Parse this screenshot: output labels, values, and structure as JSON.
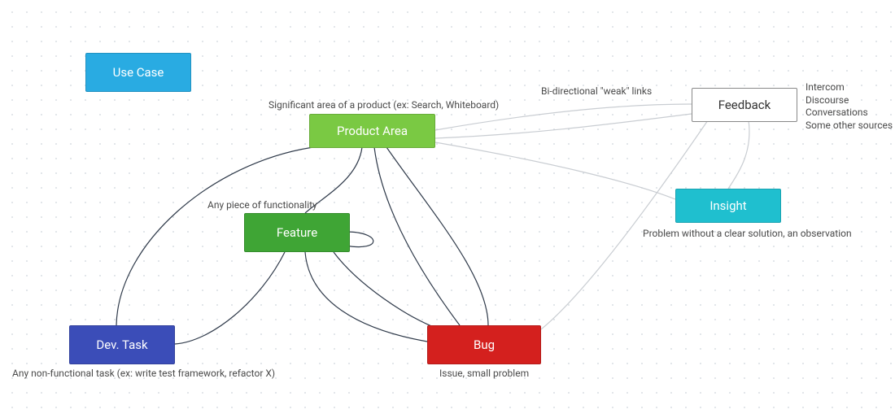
{
  "nodes": {
    "use_case": {
      "label": "Use Case",
      "color": "#29ABE2"
    },
    "product_area": {
      "label": "Product Area",
      "color": "#7AC943"
    },
    "feature": {
      "label": "Feature",
      "color": "#3FA535"
    },
    "dev_task": {
      "label": "Dev. Task",
      "color": "#3B4DB8"
    },
    "bug": {
      "label": "Bug",
      "color": "#D4201E"
    },
    "feedback": {
      "label": "Feedback",
      "color": "#FFFFFF",
      "text": "#333333",
      "border": "#888888"
    },
    "insight": {
      "label": "Insight",
      "color": "#1FBFCF"
    }
  },
  "annotations": {
    "product_area_note": "Significant area of a product (ex: Search, Whiteboard)",
    "feature_note": "Any piece of functionality",
    "dev_task_note": "Any non-functional task (ex: write test framework, refactor X)",
    "bug_note": "Issue, small problem",
    "insight_note": "Problem without a clear solution, an observation",
    "weak_links_note": "Bi-directional \"weak\" links",
    "feedback_sources": "Intercom\nDiscourse\nConversations\nSome other sources"
  },
  "colors": {
    "edge_strong": "#2F3A4A",
    "edge_weak": "#C9CDD2"
  }
}
